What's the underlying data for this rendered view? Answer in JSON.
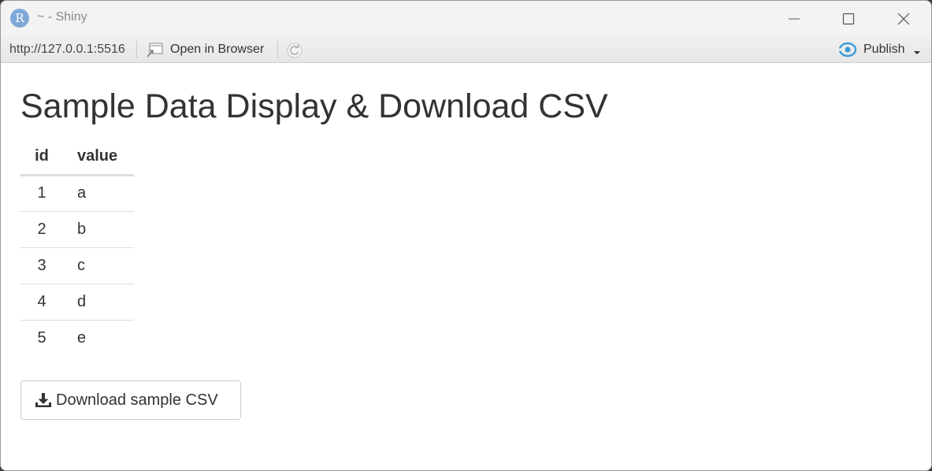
{
  "window": {
    "icon_letter": "R",
    "title": "~ - Shiny"
  },
  "toolbar": {
    "url": "http://127.0.0.1:5516",
    "open_in_browser_label": "Open in Browser",
    "publish_label": "Publish"
  },
  "main": {
    "title": "Sample Data Display & Download CSV",
    "table": {
      "columns": [
        "id",
        "value"
      ],
      "rows": [
        [
          "1",
          "a"
        ],
        [
          "2",
          "b"
        ],
        [
          "3",
          "c"
        ],
        [
          "4",
          "d"
        ],
        [
          "5",
          "e"
        ]
      ]
    },
    "download_label": "Download sample CSV"
  },
  "colors": {
    "app_icon": "#7fa8d8",
    "publish_icon": "#3a9bd9",
    "text": "#333333"
  }
}
